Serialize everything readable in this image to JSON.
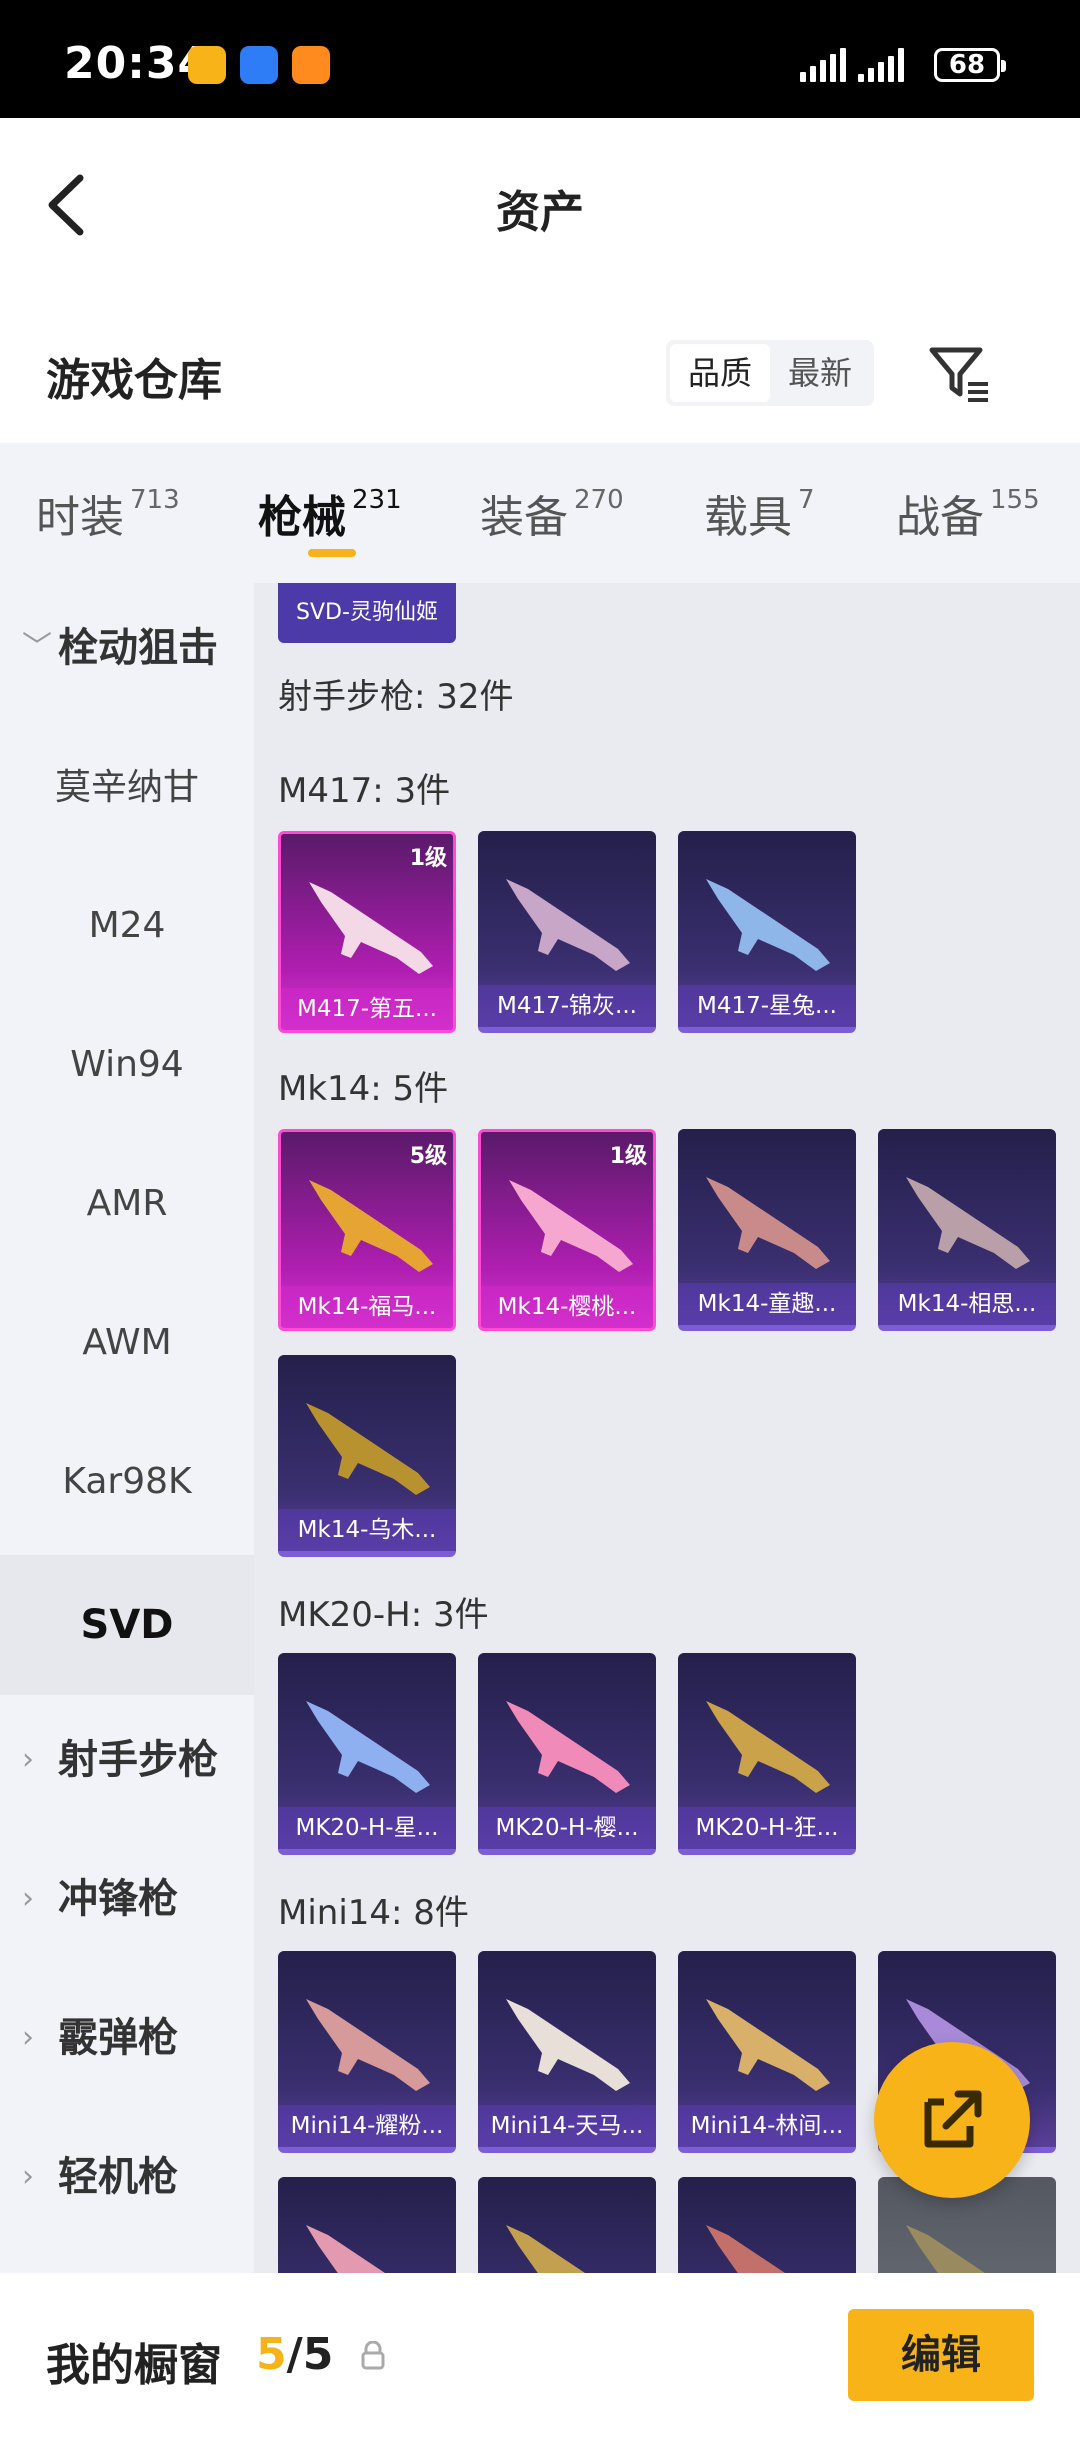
{
  "status_bar": {
    "time": "20:34",
    "battery": "68"
  },
  "header": {
    "title": "资产"
  },
  "warehouse": {
    "title": "游戏仓库",
    "sort_quality": "品质",
    "sort_latest": "最新"
  },
  "tabs": [
    {
      "label": "时装",
      "count": "713"
    },
    {
      "label": "枪械",
      "count": "231"
    },
    {
      "label": "装备",
      "count": "270"
    },
    {
      "label": "载具",
      "count": "7"
    },
    {
      "label": "战备",
      "count": "155"
    }
  ],
  "sidebar": {
    "group_marksman": "栓动狙击",
    "items": [
      "莫辛纳甘",
      "M24",
      "Win94",
      "AMR",
      "AWM",
      "Kar98K",
      "SVD"
    ],
    "groups": [
      "射手步枪",
      "冲锋枪",
      "霰弹枪",
      "轻机枪"
    ]
  },
  "content": {
    "top_chip": "SVD-灵驹仙姬",
    "dmr_header": "射手步枪: 32件",
    "sections": [
      {
        "title": "M417: 3件",
        "cards": [
          "M417-第五...",
          "M417-锦灰...",
          "M417-星兔..."
        ],
        "levels": [
          "1级"
        ]
      },
      {
        "title": "Mk14: 5件",
        "cards": [
          "Mk14-福马...",
          "Mk14-樱桃...",
          "Mk14-童趣...",
          "Mk14-相思...",
          "Mk14-乌木..."
        ],
        "levels": [
          "5级",
          "1级"
        ]
      },
      {
        "title": "MK20-H: 3件",
        "cards": [
          "MK20-H-星...",
          "MK20-H-樱...",
          "MK20-H-狂..."
        ]
      },
      {
        "title": "Mini14: 8件",
        "cards": [
          "Mini14-耀粉...",
          "Mini14-天马...",
          "Mini14-林间..."
        ]
      }
    ]
  },
  "showcase": {
    "title": "我的橱窗",
    "current": "5",
    "total": "/5",
    "edit_label": "编辑"
  },
  "colors": {
    "accent": "#f7b318",
    "purple_card": "#3a2f70",
    "pink_card": "#b01eb1"
  }
}
